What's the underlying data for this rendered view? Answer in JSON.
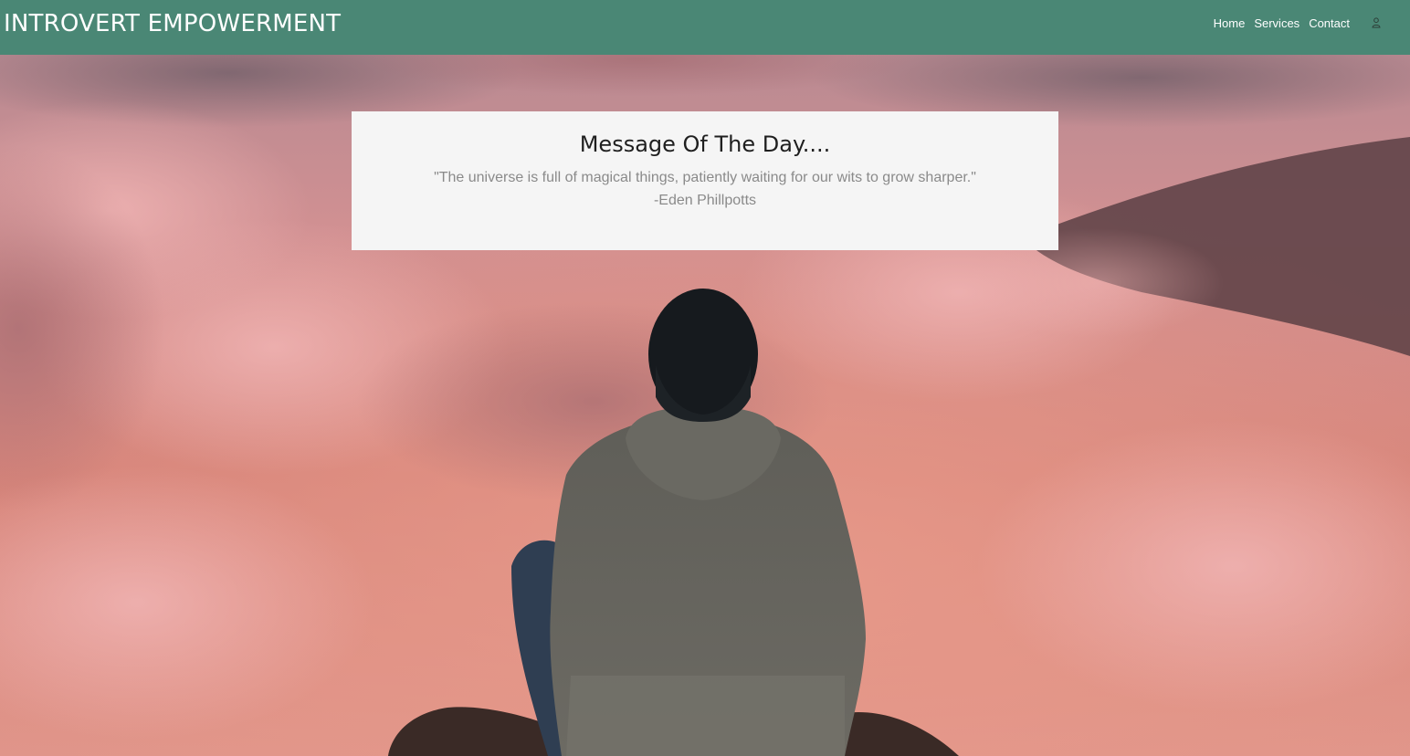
{
  "header": {
    "brand": "INTROVERT EMPOWERMENT",
    "nav": {
      "home": "Home",
      "services": "Services",
      "contact": "Contact"
    },
    "user_icon": "user-icon"
  },
  "message": {
    "title": "Message Of The Day....",
    "quote": "\"The universe is full of magical things, patiently waiting for our wits to grow sharper.\"",
    "author": "-Eden Phillpotts"
  },
  "colors": {
    "header_bg": "#4a8775",
    "card_bg": "#f5f5f5",
    "title": "#1f1f1f",
    "quote": "#8a8a8a"
  }
}
